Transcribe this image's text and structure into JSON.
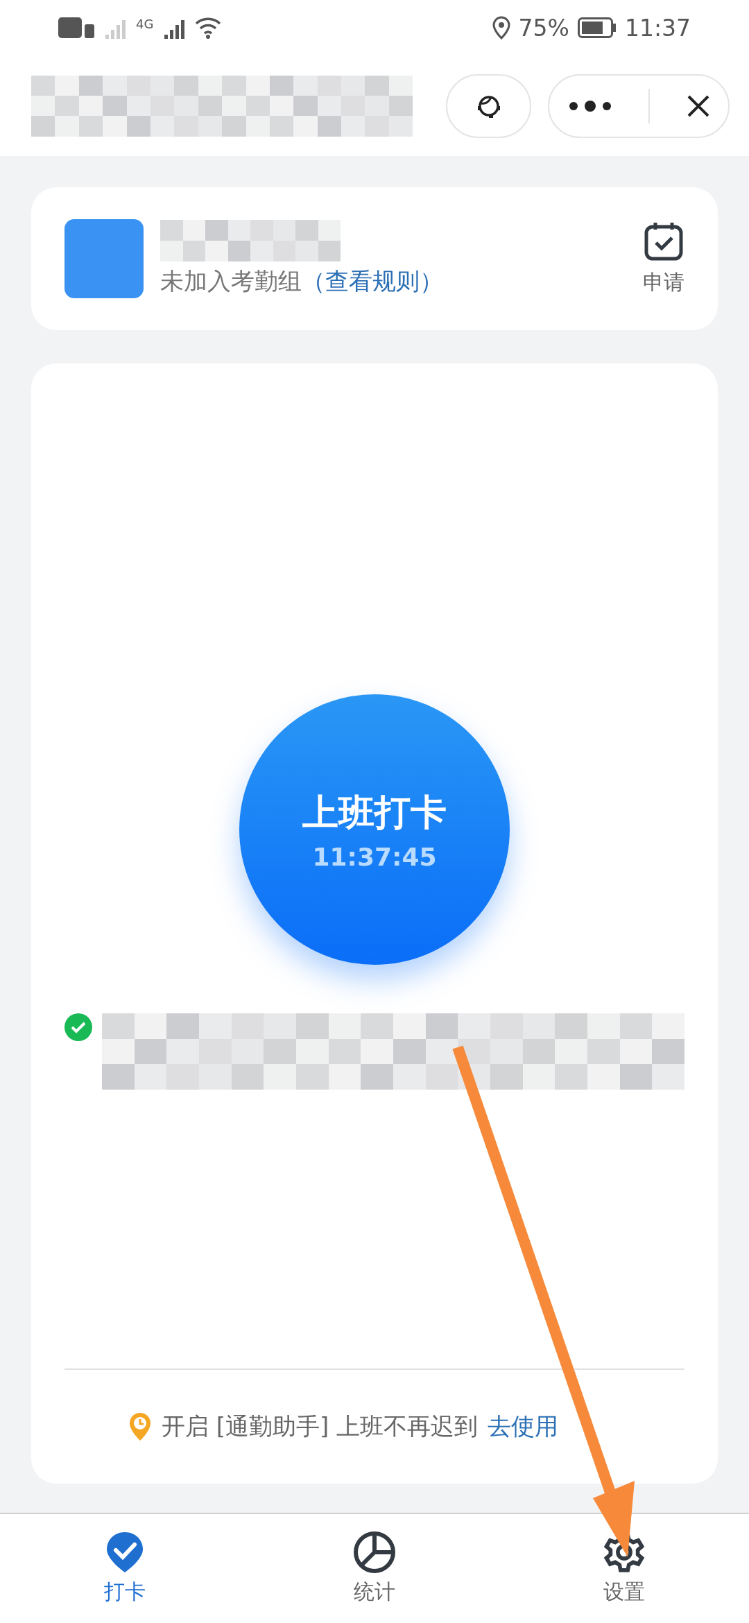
{
  "status_bar": {
    "network": "4G",
    "battery": "75%",
    "time": "11:37"
  },
  "profile_card": {
    "subtitle": "未加入考勤组",
    "rules_link": "（查看规则）",
    "apply_label": "申请"
  },
  "punch": {
    "label": "上班打卡",
    "time": "11:37:45",
    "location_verified": true
  },
  "tip": {
    "text": "开启 [通勤助手] 上班不再迟到",
    "link": "去使用"
  },
  "tabs": [
    {
      "label": "打卡",
      "kind": "check",
      "selected": true
    },
    {
      "label": "统计",
      "kind": "chart",
      "selected": false
    },
    {
      "label": "设置",
      "kind": "gear",
      "selected": false
    }
  ]
}
